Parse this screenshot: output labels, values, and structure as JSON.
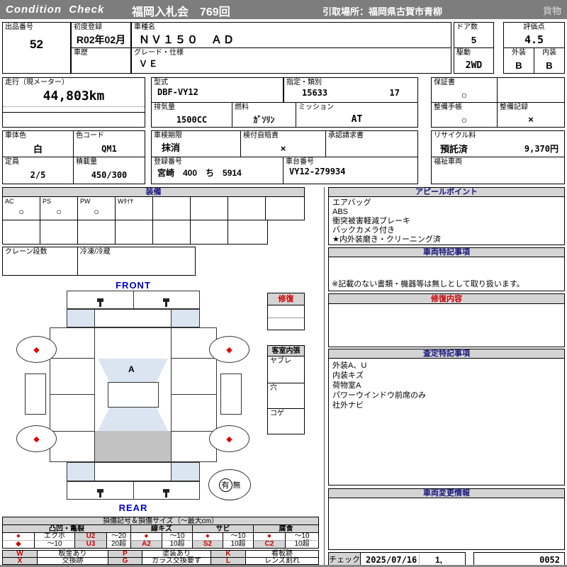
{
  "colors": {
    "red": "#cc0000",
    "navy": "#15157a",
    "blue": "#0000cc",
    "top_bar": "#7d7d7d",
    "header_gray": "#d4d4d4",
    "pale_blue": "#dbe5f1",
    "cargo_gray": "#c2c2c2"
  },
  "top_bar": {
    "brand": "Condition  Check",
    "auction": "福岡入札会　769回",
    "pickup": "引取場所：福岡県古賀市青柳",
    "category": "貨物"
  },
  "info": {
    "lot_label": "出品番号",
    "lot": "52",
    "first_reg_label": "初度登録",
    "first_reg": "R02年02月",
    "history_label": "車歴",
    "model_label": "車種名",
    "model": "ＮＶ１５０　ＡＤ",
    "grade_label": "グレード・仕様",
    "grade": "ＶＥ",
    "doors_label": "ドア数",
    "doors": "5",
    "score_label": "評価点",
    "score": "4.5",
    "drive_label": "駆動",
    "drive": "2WD",
    "exterior_label": "外装",
    "exterior": "B",
    "interior_label": "内装",
    "interior": "B",
    "mileage_label": "走行（現メーター）",
    "mileage": "44,803km",
    "model_code_label": "型式",
    "model_code": "DBF-VY12",
    "class_label": "指定・類別",
    "class_no1": "15633",
    "class_no2": "17",
    "displacement_label": "排気量",
    "displacement": "1500CC",
    "fuel_label": "燃料",
    "fuel": "ｶﾞｿﾘﾝ",
    "mission_label": "ミッション",
    "mission": "AT",
    "warranty_label": "保証書",
    "warranty": "○",
    "maintenance_book_label": "整備手帳",
    "maintenance_book": "○",
    "maintenance_record_label": "整備記録",
    "maintenance_record": "×",
    "body_color_label": "車体色",
    "body_color": "白",
    "color_code_label": "色コード",
    "color_code": "QM1",
    "capacity_label": "定員",
    "capacity": "2/5",
    "load_label": "積載量",
    "load": "450/300",
    "inspection_label": "車検期限",
    "inspection": "抹消",
    "insurance_label": "検付自賠責",
    "insurance": "×",
    "approval_label": "承認請求書",
    "registration_label": "登録番号",
    "registration": "宮崎　400　ち　5914",
    "chassis_label": "車台番号",
    "chassis": "VY12-279934",
    "recycle_label": "リサイクル料",
    "recycle_status": "預託済",
    "recycle_fee": "9,370円",
    "welfare_label": "福祉車両"
  },
  "equipment": {
    "title": "装備",
    "cells": [
      {
        "label": "AC",
        "mark": "○"
      },
      {
        "label": "PS",
        "mark": "○"
      },
      {
        "label": "PW",
        "mark": "○"
      },
      {
        "label": "Wﾀｲﾔ",
        "mark": ""
      }
    ],
    "crane_label": "クレーン段数",
    "fridge_label": "冷凍/冷蔵"
  },
  "appeal": {
    "title": "アピールポイント",
    "lines": [
      "エアバッグ",
      "ABS",
      "衝突被害軽減ブレーキ",
      "バックカメラ付き",
      "★内外装磨き・クリーニング済"
    ]
  },
  "vehicle_notes": {
    "title": "車両特記事項",
    "note": "※記載のない書類・機器等は無しとして取り扱います。"
  },
  "repair_content": {
    "title": "修復内容"
  },
  "assessment": {
    "title": "査定特記事項",
    "lines": [
      "外装A、U",
      "内装キズ",
      "荷物室A",
      "パワーウインドウ前席のみ",
      "社外ナビ"
    ]
  },
  "change_info": {
    "title": "車両変更情報"
  },
  "check_row": {
    "label": "チェック",
    "date": "2025/07/16",
    "value": "1,",
    "serial": "0052"
  },
  "diagram": {
    "front": "FRONT",
    "rear": "REAR",
    "glass_mark": "A",
    "wheel_mark": "◆",
    "spare_yes": "有",
    "spare_no": "無",
    "repair_title": "修復",
    "cabin_title": "客室内張",
    "cabin_rows": [
      "ヤブレ",
      "穴",
      "コゲ"
    ]
  },
  "legend": {
    "title": "損傷記号＆損傷サイズ（～最大cm）",
    "groups": [
      "凸凹・亀裂",
      "線キズ",
      "サビ",
      "腐食"
    ],
    "dent_row1": [
      "◆",
      "エクボ",
      "U2",
      "～20"
    ],
    "dent_row2": [
      "◆",
      "～10",
      "U3",
      "20超"
    ],
    "scratch_row1": [
      "◆",
      "～10"
    ],
    "scratch_row2": [
      "A2",
      "10超"
    ],
    "rust_row1": [
      "◆",
      "～10"
    ],
    "rust_row2": [
      "S2",
      "10超"
    ],
    "corrosion_row1": [
      "◆",
      "～10"
    ],
    "corrosion_row2": [
      "C2",
      "10超"
    ],
    "codes": [
      {
        "code": "W",
        "desc": "板金あり"
      },
      {
        "code": "P",
        "desc": "塗装あり"
      },
      {
        "code": "K",
        "desc": "看板跡"
      },
      {
        "code": "X",
        "desc": "交換跡"
      },
      {
        "code": "G",
        "desc": "ガラス交換要す"
      },
      {
        "code": "L",
        "desc": "レンズ割れ"
      }
    ]
  }
}
